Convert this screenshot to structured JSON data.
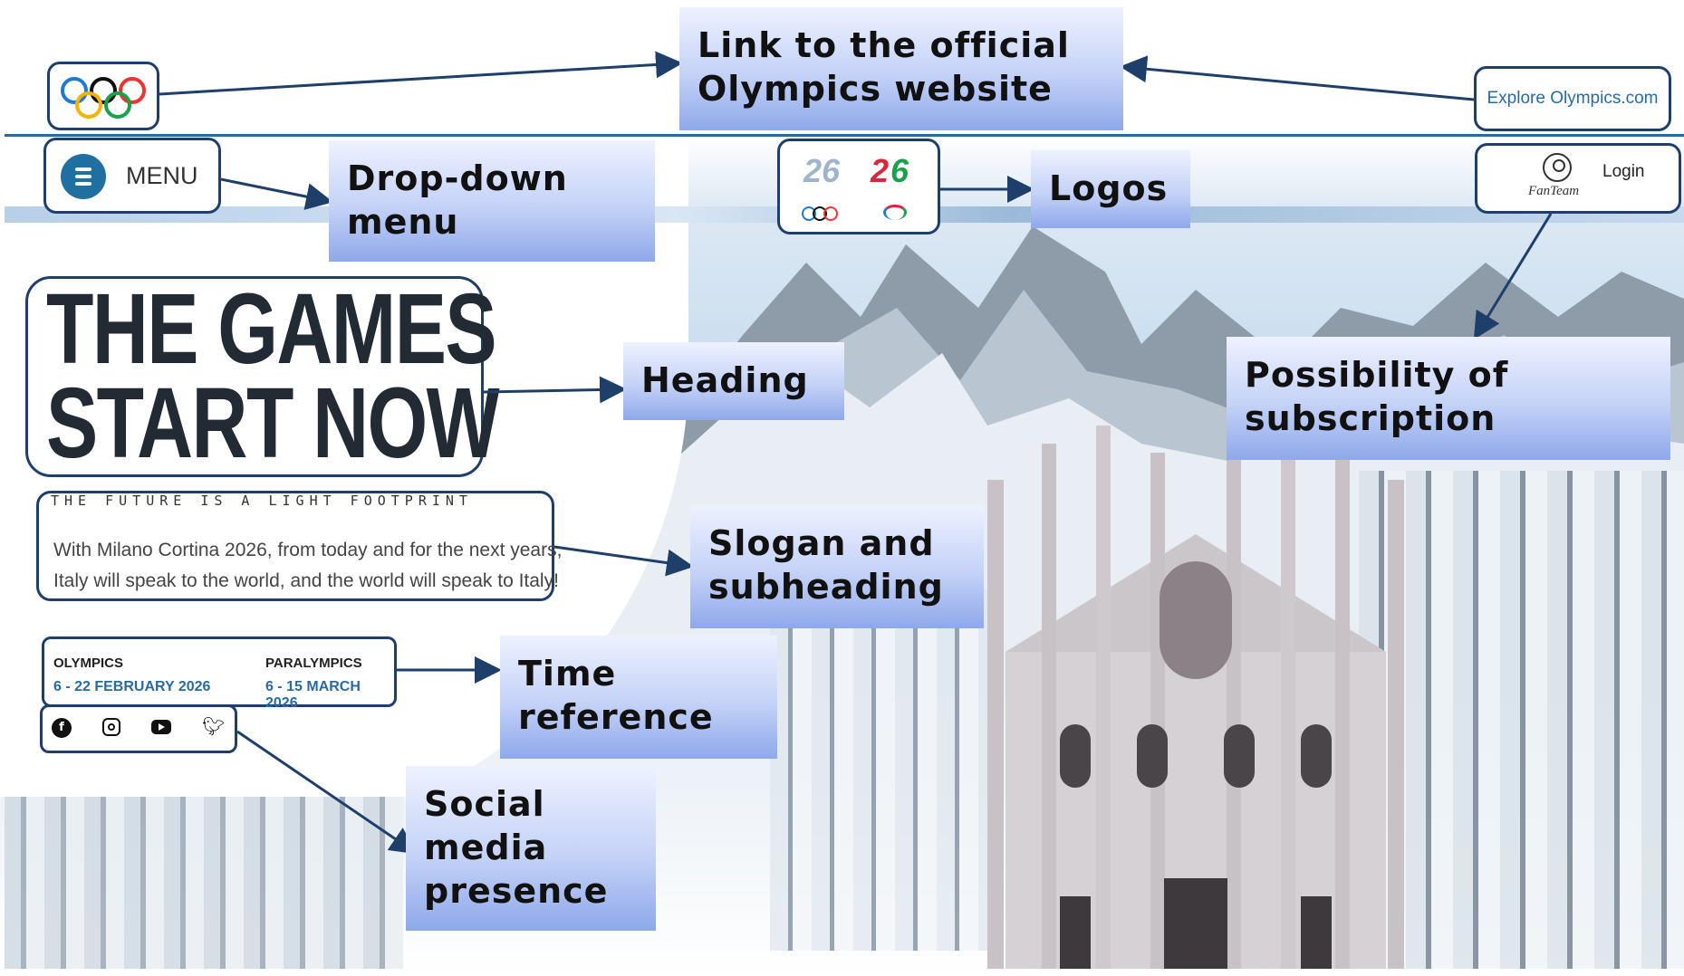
{
  "header": {
    "explore_link": "Explore Olympics.com",
    "menu_label": "MENU",
    "login_label": "Login",
    "fanteam_label": "FanTeam"
  },
  "hero": {
    "heading_line1": "THE GAMES",
    "heading_line2": "START NOW",
    "slogan": "THE FUTURE IS A LIGHT FOOTPRINT",
    "subheading_line1": "With Milano Cortina 2026, from today and for the next years,",
    "subheading_line2": "Italy will speak to the world, and the world will speak to Italy!"
  },
  "dates": {
    "olympics_label": "OLYMPICS",
    "olympics_dates": "6 - 22 FEBRUARY 2026",
    "paralympics_label": "PARALYMPICS",
    "paralympics_dates": "6 - 15 MARCH 2026"
  },
  "social": {
    "icons": [
      "facebook-icon",
      "instagram-icon",
      "youtube-icon",
      "twitter-icon"
    ]
  },
  "callouts": {
    "official_link": [
      "Link to the official",
      "Olympics website"
    ],
    "dropdown": [
      "Drop-down",
      "menu"
    ],
    "logos": [
      "Logos"
    ],
    "heading": [
      "Heading"
    ],
    "subscription": [
      "Possibility of",
      "subscription"
    ],
    "slogan": [
      "Slogan and",
      "subheading"
    ],
    "time": [
      "Time",
      "reference"
    ],
    "social": [
      "Social",
      "media",
      "presence"
    ]
  },
  "colors": {
    "box_border": "#1f3f6b",
    "accent_blue": "#2b6aa0",
    "menu_circle": "#1f6fa0",
    "callout_gradient_end": "#8ea8ea"
  }
}
